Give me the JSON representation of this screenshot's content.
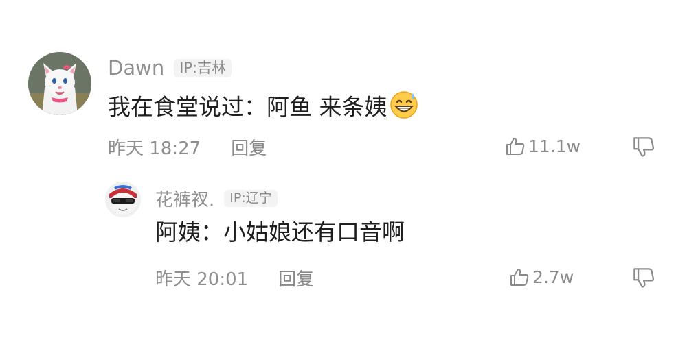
{
  "comments": [
    {
      "username": "Dawn",
      "ip": "IP:吉林",
      "text": "我在食堂说过：阿鱼 来条姨",
      "emoji": "grinning-sweat-emoji",
      "time": "昨天 18:27",
      "reply_label": "回复",
      "likes": "11.1w"
    },
    {
      "username": "花裤衩.",
      "ip": "IP:辽宁",
      "text": "阿姨：小姑娘还有口音啊",
      "time": "昨天 20:01",
      "reply_label": "回复",
      "likes": "2.7w"
    }
  ],
  "icons": {
    "like": "thumbs-up-icon",
    "dislike": "thumbs-down-icon"
  },
  "colors": {
    "username": "#8f8f8f",
    "text": "#1f1f1f",
    "meta": "#8f8f8f",
    "badge_bg": "#f3f3f3"
  }
}
